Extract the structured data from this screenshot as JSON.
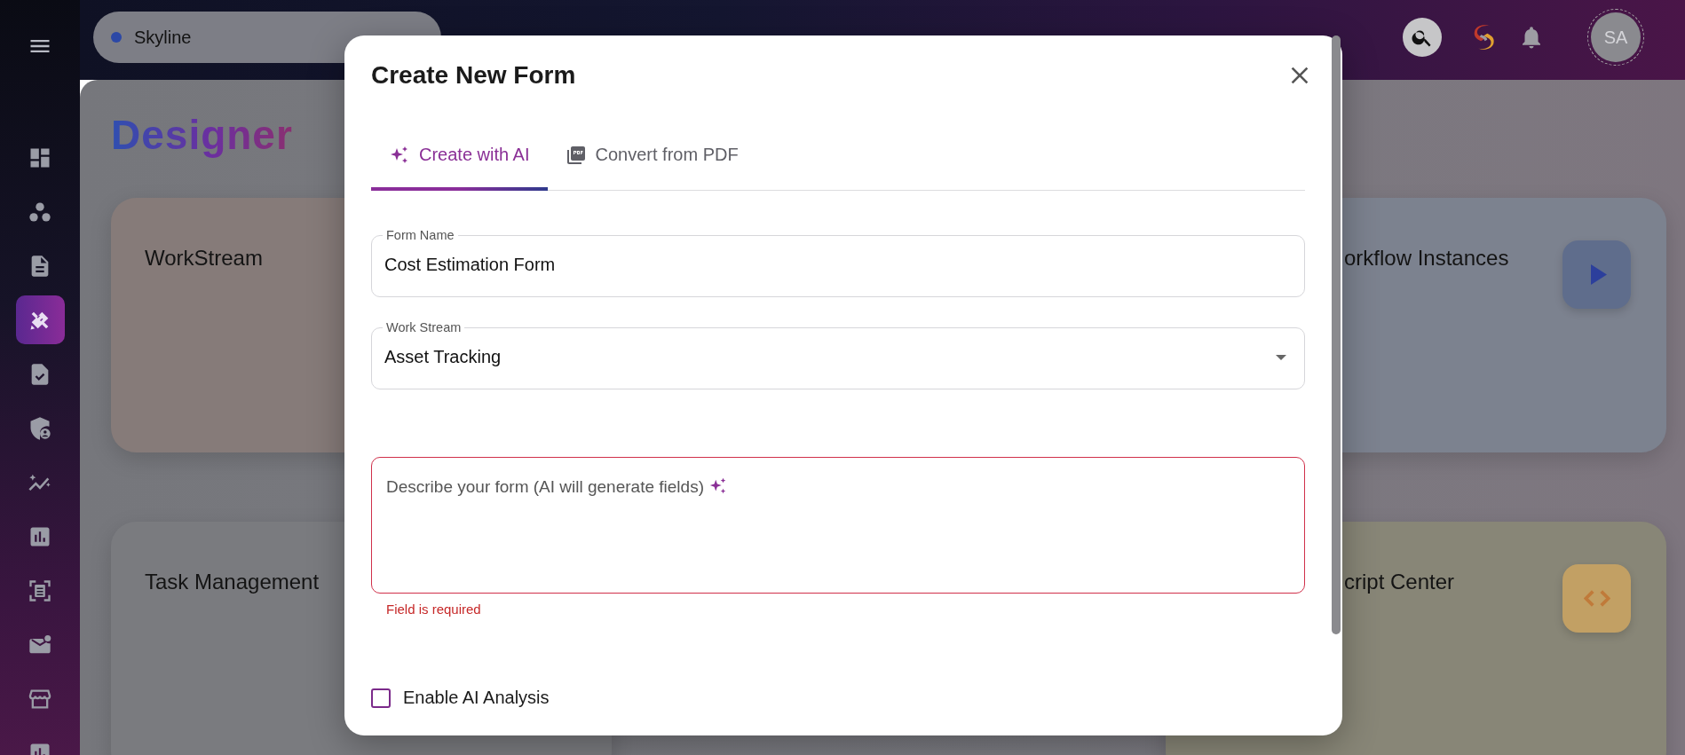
{
  "sidebar": {
    "items": [
      {
        "selected": false
      },
      {
        "selected": false
      },
      {
        "selected": false
      },
      {
        "selected": true
      },
      {
        "selected": false
      },
      {
        "selected": false
      },
      {
        "selected": false
      },
      {
        "selected": false
      },
      {
        "selected": false
      },
      {
        "selected": false
      },
      {
        "selected": false
      },
      {
        "selected": false
      }
    ]
  },
  "header": {
    "workspace": "Skyline",
    "avatar": "SA"
  },
  "page_title": "Designer",
  "cards": [
    {
      "title": "WorkStream",
      "color": "#867b79"
    },
    {
      "title": "orkflow Instances",
      "color": "#7c828f"
    },
    {
      "title": "Task Management",
      "color": "#7a7b7f"
    },
    {
      "title": "cript Center",
      "color": "#888677"
    }
  ],
  "dialog": {
    "title": "Create New Form",
    "tabs": [
      {
        "label": "Create with AI",
        "selected": true
      },
      {
        "label": "Convert from PDF",
        "selected": false
      }
    ],
    "fields": [
      {
        "kind": "text",
        "label": "Form Name",
        "value": "Cost Estimation Form"
      },
      {
        "kind": "select",
        "label": "Work Stream",
        "value": "Asset Tracking"
      },
      {
        "kind": "textarea",
        "placeholder": "Describe your form (AI will generate fields)",
        "error": "Field is required"
      }
    ],
    "checkbox": {
      "label": "Enable AI Analysis",
      "checked": false
    }
  }
}
